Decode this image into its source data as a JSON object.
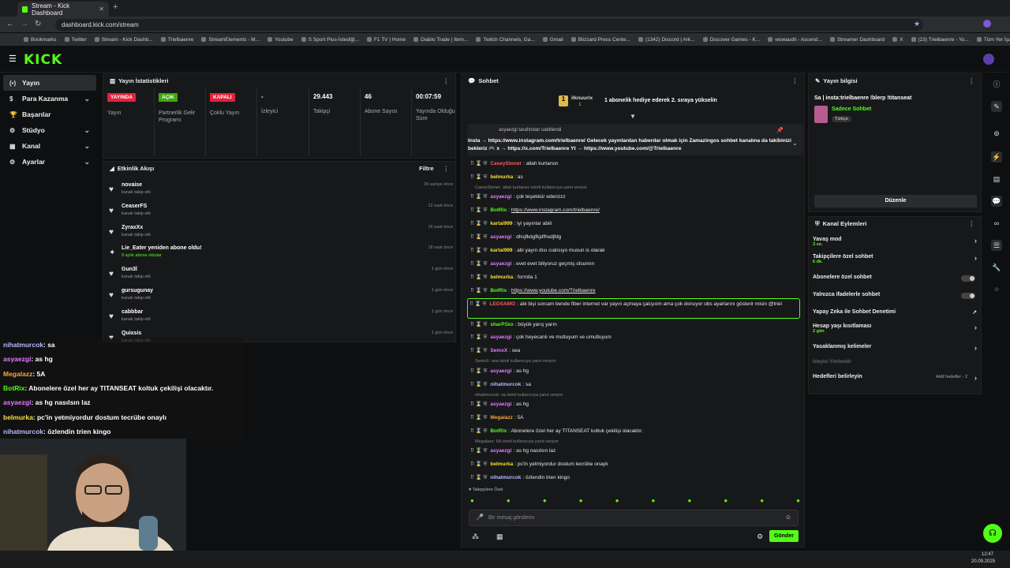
{
  "browser": {
    "tab_title": "Stream - Kick Dashboard",
    "url": "dashboard.kick.com/stream",
    "bookmarks": [
      "Bookmarks",
      "Twitter",
      "Stream - Kick Dashb...",
      "Trielbaenre",
      "StreamElements - M...",
      "Youtube",
      "S Sport Plus-İstediği...",
      "F1 TV | Home",
      "Diablo Trade | Item...",
      "Twitch Channels, Ga...",
      "Gmail",
      "Blizzard Press Cente...",
      "(1342) Discord | Ark...",
      "Discover Games - K...",
      "wowaudit - Ascend...",
      "Streamer Dashboard",
      "X",
      "(23) Trielbaenre - Yo...",
      "Tüm Yer İşaretleri"
    ]
  },
  "app": {
    "logo": "KICK"
  },
  "sidebar": {
    "items": [
      {
        "label": "Yayın",
        "active": true
      },
      {
        "label": "Para Kazanma",
        "chevron": true
      },
      {
        "label": "Başarılar"
      },
      {
        "label": "Stüdyo",
        "chevron": true
      },
      {
        "label": "Kanal",
        "chevron": true
      },
      {
        "label": "Ayarlar",
        "chevron": true
      }
    ]
  },
  "stats": {
    "title": "Yayın İstatistikleri",
    "items": [
      {
        "badge": "YAYINDA",
        "badge_color": "#e3223b",
        "label": "Yayın"
      },
      {
        "badge": "AÇIK",
        "badge_color": "#3fa512",
        "label": "Partnerlik Gelir Programı"
      },
      {
        "badge": "KAPALI",
        "badge_color": "#e3223b",
        "label": "Çoklu Yayın"
      },
      {
        "value": "-",
        "label": "İzleyici"
      },
      {
        "value": "29.443",
        "label": "Takipçi"
      },
      {
        "value": "46",
        "label": "Abone Sayısı"
      },
      {
        "value": "00:07:59",
        "label": "Yayında Olduğu Süre"
      }
    ]
  },
  "activity": {
    "title": "Etkinlik Akışı",
    "filter": "Filtre",
    "rows": [
      {
        "name": "novaise",
        "sub": "kanalı takip etti",
        "time": "29 saniye önce",
        "icon": "heart"
      },
      {
        "name": "CeaserFS",
        "sub": "kanalı takip etti",
        "time": "12 saat önce",
        "icon": "heart"
      },
      {
        "name": "ZyraxXx",
        "sub": "kanalı takip etti",
        "time": "16 saat önce",
        "icon": "heart"
      },
      {
        "name": "Lie_Eater yeniden abone oldu!",
        "sub": "9 aylık abone oldular",
        "time": "18 saat önce",
        "icon": "star"
      },
      {
        "name": "Gun3l",
        "sub": "kanalı takip etti",
        "time": "1 gün önce",
        "icon": "heart"
      },
      {
        "name": "gursugunay",
        "sub": "kanalı takip etti",
        "time": "1 gün önce",
        "icon": "heart"
      },
      {
        "name": "cabbbar",
        "sub": "kanalı takip etti",
        "time": "1 gün önce",
        "icon": "heart"
      },
      {
        "name": "Quixsis",
        "sub": "kanalı takip etti",
        "time": "1 gün önce",
        "icon": "heart"
      }
    ]
  },
  "overlay_chat": [
    {
      "user": "nihatmurcok",
      "color": "#b9b9ff",
      "text": ": sa"
    },
    {
      "user": "asyaezgi",
      "color": "#e27bff",
      "text": ": as hg"
    },
    {
      "user": "Megalazz",
      "color": "#f7a735",
      "text": ": 5A"
    },
    {
      "user": "BotRix",
      "color": "#53fc18",
      "text": ": Abonelere özel her ay TITANSEAT koltuk çekilişi olacaktır."
    },
    {
      "user": "asyaezgi",
      "color": "#e27bff",
      "text": ": as hg nasılsın laz"
    },
    {
      "user": "belmurka",
      "color": "#f7e135",
      "text": ": pc'in yetmiyordur dostum tecrübe onaylı"
    },
    {
      "user": "nihatmurcok",
      "color": "#b9b9ff",
      "text": ": özlendin trien kingo"
    }
  ],
  "chat": {
    "title": "Sohbet",
    "goal_user": "ilknuurix",
    "goal_count": "1",
    "goal_text": "1 abonelik hediye ederek 2. sıraya yükselin",
    "pinned_by": "asyaezgi tarafından sabitlendi",
    "pinned_text": "Insta → https://www.instagram.com/trielbaenre/ Gelecek yayınlardan haberdar olmak için Zamazingos sohbet kanalına da takibinizi bekleriz 🎮 x → https://x.com/Trielbaenre Yt → https://www.youtube.com/@Trielbaenre",
    "messages": [
      {
        "type": "msg",
        "user": "CaseyStoner",
        "color": "#ff5c5c",
        "text": "allah kurtarsın"
      },
      {
        "type": "msg",
        "user": "belmurka",
        "color": "#f7e135",
        "text": "as"
      },
      {
        "type": "reply",
        "text": "CaseyStoner: allah kurtarsın isimli kullanıcıya yanıt veriyor"
      },
      {
        "type": "msg",
        "user": "asyaezgi",
        "color": "#e27bff",
        "text": "çok teşekkür ederizzz"
      },
      {
        "type": "msg",
        "user": "BotRix",
        "color": "#53fc18",
        "text": "https://www.instagram.com/trielbaenre/",
        "link": true
      },
      {
        "type": "msg",
        "user": "kartal999",
        "color": "#f7e135",
        "text": "iyi yayınlar abiii"
      },
      {
        "type": "msg",
        "user": "asyaezgi",
        "color": "#e27bff",
        "text": "dhsjfkdgfkjdfhsdjfdg"
      },
      {
        "type": "msg",
        "user": "kartal999",
        "color": "#f7e135",
        "text": "abi yayın dısı cıalısıyo musun is olarak"
      },
      {
        "type": "msg",
        "user": "asyaezgi",
        "color": "#e27bff",
        "text": "evet evet biliyoruz geçmiş olsunnn"
      },
      {
        "type": "msg",
        "user": "belmurka",
        "color": "#f7e135",
        "text": "formila 1"
      },
      {
        "type": "msg",
        "user": "BotRix",
        "color": "#53fc18",
        "text": "https://www.youtube.com/Trielbaenre",
        "link": true
      },
      {
        "type": "msg",
        "user": "LEOSAMO",
        "color": "#ff5c5c",
        "text": "abi bişi sorcam bende fiber internet var yayın açmaya çalışıom ama çok donuyor obs ayarlarını gösterir misin @triel",
        "highlight": true
      },
      {
        "type": "msg",
        "user": "sharP1ko",
        "color": "#53fc18",
        "text": "büyük yarış yarın"
      },
      {
        "type": "msg",
        "user": "asyaezgi",
        "color": "#e27bff",
        "text": "çok heyecanlı ve mutluyum ve umutluyum"
      },
      {
        "type": "msg",
        "user": "SemxX",
        "color": "#e27bff",
        "text": "sea"
      },
      {
        "type": "reply",
        "text": "SemxX: sea isimli kullanıcıya yanıt veriyor"
      },
      {
        "type": "msg",
        "user": "asyaezgi",
        "color": "#e27bff",
        "text": "as hg"
      },
      {
        "type": "msg",
        "user": "nihatmurcok",
        "color": "#b9b9ff",
        "text": "sa"
      },
      {
        "type": "reply",
        "text": "nihatmurcok: sa isimli kullanıcıya yanıt veriyor"
      },
      {
        "type": "msg",
        "user": "asyaezgi",
        "color": "#e27bff",
        "text": "as hg"
      },
      {
        "type": "msg",
        "user": "Megalazz",
        "color": "#f7a735",
        "text": "5A"
      },
      {
        "type": "msg",
        "user": "BotRix",
        "color": "#53fc18",
        "text": "Abonelere özel her ay TITANSEAT koltuk çekilişi olacaktır."
      },
      {
        "type": "reply",
        "text": "Megalazz: 5A isimli kullanıcıya yanıt veriyor"
      },
      {
        "type": "msg",
        "user": "asyaezgi",
        "color": "#e27bff",
        "text": "as hg nasılsın laz"
      },
      {
        "type": "msg",
        "user": "belmurka",
        "color": "#f7e135",
        "text": "pc'in yetmiyordur dostum tecrübe onaylı"
      },
      {
        "type": "msg",
        "user": "nihatmurcok",
        "color": "#b9b9ff",
        "text": "özlendin trien kingo"
      }
    ],
    "followers_only": "Takipçilere Özel",
    "input_placeholder": "Bir mesaj gönderin",
    "send": "Gönder"
  },
  "stream_info": {
    "title": "Yayın bilgisi",
    "stream_title": "Sa | insta:trielbaenre !blerp !titanseat",
    "category": "Sadece Sohbet",
    "language": "Türkçe",
    "edit": "Düzenle"
  },
  "channel_actions": {
    "title": "Kanal Eylemleri",
    "items": [
      {
        "label": "Yavaş mod",
        "sub": "3 sn.",
        "kind": "arrow"
      },
      {
        "label": "Takipçilere özel sohbet",
        "sub": "6 dk.",
        "kind": "arrow"
      },
      {
        "label": "Abonelere özel sohbet",
        "kind": "toggle"
      },
      {
        "label": "Yalnızca ifadelerle sohbet",
        "kind": "toggle"
      },
      {
        "label": "Yapay Zeka ile Sohbet Denetimi",
        "kind": "external"
      },
      {
        "label": "Hesap yaşı kısıtlaması",
        "sub": "2 gün",
        "kind": "arrow"
      },
      {
        "label": "Yasaklanmış kelimeler",
        "kind": "arrow"
      },
      {
        "label": "İzleyici Yönlendir",
        "kind": "disabled"
      },
      {
        "label": "Hedefleri belirleyin",
        "extra": "Aktif hedefler - 2",
        "kind": "arrow"
      }
    ]
  },
  "taskbar": {
    "time": "12:47",
    "date": "20.09.2025"
  },
  "colors": {
    "accent": "#53fc18",
    "live": "#e3223b"
  }
}
